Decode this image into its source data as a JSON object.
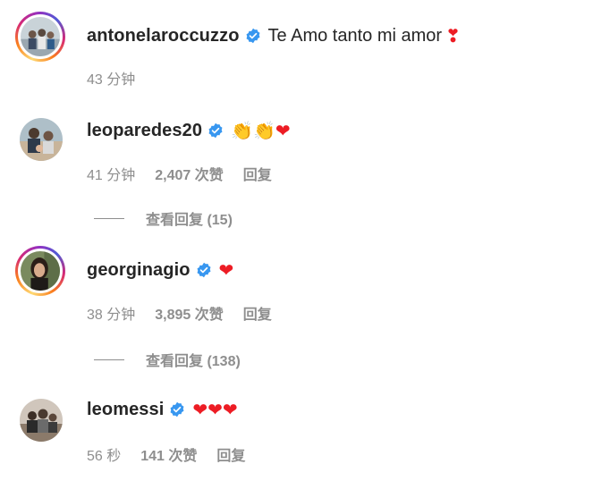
{
  "comments": [
    {
      "username": "antonelaroccuzzo",
      "verified": true,
      "text": "Te Amo tanto mi amor",
      "emoji": "❣",
      "time": "43 分钟",
      "likes": "",
      "reply": "",
      "view_replies": ""
    },
    {
      "username": "leoparedes20",
      "verified": true,
      "text": "",
      "emoji": "👏👏❤",
      "time": "41 分钟",
      "likes": "2,407 次赞",
      "reply": "回复",
      "view_replies": "查看回复 (15)"
    },
    {
      "username": "georginagio",
      "verified": true,
      "text": "",
      "emoji": "❤",
      "time": "38 分钟",
      "likes": "3,895 次赞",
      "reply": "回复",
      "view_replies": "查看回复 (138)"
    },
    {
      "username": "leomessi",
      "verified": true,
      "text": "",
      "emoji": "❤❤❤",
      "time": "56 秒",
      "likes": "141 次赞",
      "reply": "回复",
      "view_replies": ""
    }
  ],
  "colors": {
    "text": "#262626",
    "secondary": "#8e8e8e",
    "verified": "#3897f0",
    "heart": "#ed1c24"
  }
}
